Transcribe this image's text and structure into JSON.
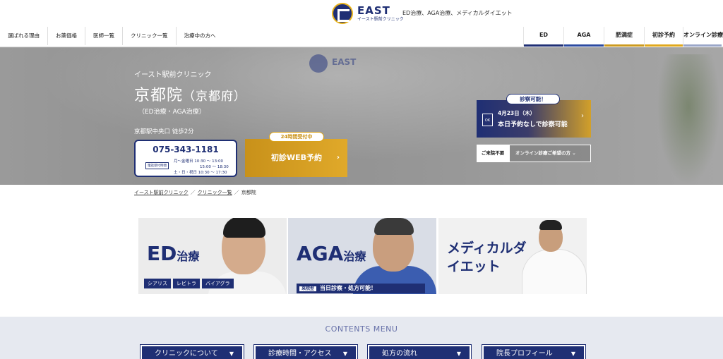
{
  "header": {
    "logo_text": "EAST",
    "logo_sub": "イースト駅前クリニック",
    "tagline": "ED治療、AGA治療、メディカルダイエット"
  },
  "nav": {
    "left": [
      "選ばれる理由",
      "お薬価格",
      "医師一覧",
      "クリニック一覧",
      "治療中の方へ"
    ],
    "right": [
      "ED",
      "AGA",
      "肥満症",
      "初診予約",
      "オンライン診療"
    ]
  },
  "hero": {
    "sub": "イースト駅前クリニック",
    "title": "京都院",
    "pref": "（京都府）",
    "treatments": "（ED治療・AGA治療）",
    "access": "京都駅中央口 徒歩2分",
    "phone": {
      "number": "075-343-1181",
      "label": "電話受付時間",
      "hours": [
        "月～金曜日 10:30 ～ 13:00",
        "15:00 ～ 18:30",
        "土・日・祝日 10:30 ～ 17:30"
      ]
    },
    "web": {
      "badge": "24時間受付中",
      "label": "初診WEB予約",
      "arrow": "›"
    },
    "availability": {
      "badge": "診察可能！",
      "ok": "OK",
      "date": "4月23日（木）",
      "main": "本日予約なしで診察可能",
      "arrow": "›"
    },
    "online": {
      "label": "ご来院不要",
      "button": "オンライン診療ご希望の方",
      "caret": "⌄"
    }
  },
  "breadcrumb": [
    "イースト駅前クリニック",
    "クリニック一覧",
    "京都院"
  ],
  "breadcrumb_sep": "／",
  "banners": {
    "ed": {
      "title": "ED",
      "title_suffix": "治療",
      "tags": [
        "シアリス",
        "レビトラ",
        "バイアグラ"
      ]
    },
    "aga": {
      "title": "AGA",
      "title_suffix": "治療",
      "type": "来院型",
      "note": "当日診察・処方可能！"
    },
    "diet": {
      "title": "メディカルダイエット"
    }
  },
  "contents": {
    "title": "CONTENTS MENU",
    "items": [
      "クリニックについて",
      "診療時間・アクセス",
      "処方の流れ",
      "院長プロフィール"
    ],
    "caret": "▼"
  }
}
